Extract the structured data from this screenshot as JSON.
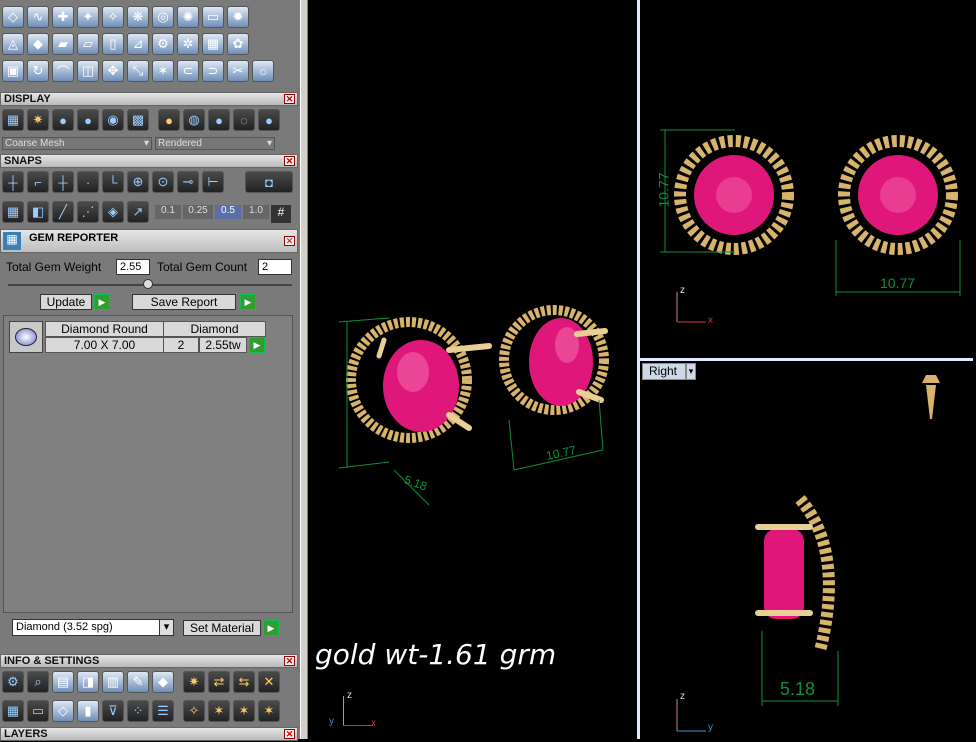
{
  "toolbar_top_rows": [
    [
      "plane-icon",
      "curve-icon",
      "add-gem-icon",
      "gem-on-curve-icon",
      "gem-cluster-icon",
      "pave-icon",
      "prong-icon",
      "gallery-icon",
      "bezel-icon",
      "layer-icon"
    ],
    [
      "surface-icon",
      "diamond-icon",
      "shape-icon",
      "cutter-icon",
      "door-icon",
      "bail-icon",
      "gear-icon",
      "cog-icon",
      "image-icon",
      "filigree-icon"
    ],
    [
      "boxes-icon",
      "rotate-icon",
      "arc-icon",
      "mirror-icon",
      "move-icon",
      "scale-icon",
      "explode-icon",
      "link-icon",
      "split-icon",
      "cut-icon",
      "ring-icon"
    ]
  ],
  "display": {
    "title": "DISPLAY",
    "mesh_select": "Coarse Mesh",
    "render_select": "Rendered"
  },
  "snaps": {
    "title": "SNAPS",
    "values": [
      "0.1",
      "0.25",
      "0.5",
      "1.0"
    ]
  },
  "gem_reporter": {
    "title": "GEM REPORTER",
    "total_weight_label": "Total Gem Weight",
    "total_weight_value": "2.55",
    "total_count_label": "Total Gem Count",
    "total_count_value": "2",
    "update_label": "Update",
    "save_report_label": "Save Report",
    "row": {
      "shape": "Diamond Round",
      "size": "7.00 X 7.00",
      "material": "Diamond",
      "count": "2",
      "weight": "2.55tw"
    },
    "material_select": "Diamond     (3.52 spg)",
    "set_material_label": "Set Material"
  },
  "info_settings": {
    "title": "INFO & SETTINGS"
  },
  "layers": {
    "title": "LAYERS"
  },
  "viewports": {
    "perspective_note": "gold  wt-1.61 grm",
    "top_dim_height": "10.77",
    "top_dim_width": "10.77",
    "persp_dim_a": "5.18",
    "persp_dim_b": "10.77",
    "right_view_label": "Right",
    "right_dim": "5.18",
    "axis_z": "z",
    "axis_x": "x",
    "axis_y": "y"
  },
  "colors": {
    "gem": "#e0177a",
    "gold": "#d8b46a",
    "dimension": "#0f8f3a"
  }
}
